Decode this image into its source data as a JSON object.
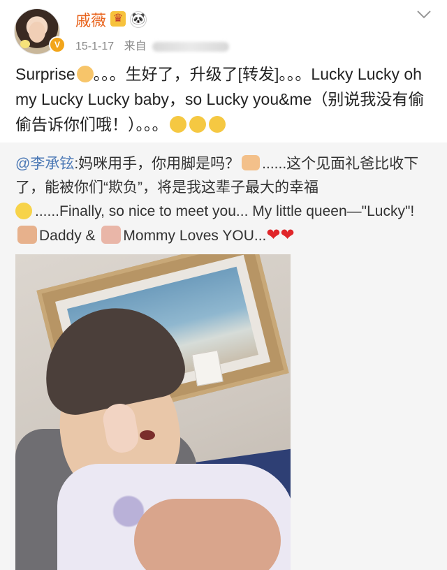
{
  "post": {
    "username": "戚薇",
    "crown_emoji": "♛",
    "panda_emoji": "🐼",
    "date": "15-1-17",
    "source_prefix": "来自",
    "verified_mark": "V",
    "text_part1": "Surprise",
    "text_part2": "。。。生好了，升级了[转发]。。。Lucky Lucky oh my Lucky Lucky baby，so Lucky you&me（别说我没有偷偷告诉你们哦！）。。。"
  },
  "repost": {
    "mention": "@李承铉",
    "text_part1": ":妈咪用手，你用脚是吗？",
    "text_part2": "......这个见面礼爸比收下了，能被你们“欺负”，将是我这辈子最大的幸福",
    "text_part3": "......Finally, so nice to meet you... My little queen—\"Lucky\"!",
    "text_part4": "Daddy &",
    "text_part5": "Mommy Loves YOU...",
    "hearts": "❤❤"
  },
  "icons": [
    "crown-emoji",
    "panda-emoji",
    "victory-hand-emoji",
    "thinking-face-emoji",
    "thumbs-up-emoji",
    "smiley-emoji",
    "dad-emoji",
    "mom-emoji",
    "heart-emoji",
    "chevron-down-icon",
    "verified-badge-icon"
  ],
  "colors": {
    "username": "#e8631c",
    "mention": "#4b78b5",
    "repost_bg": "#f5f5f5",
    "meta": "#8a8a8a"
  }
}
